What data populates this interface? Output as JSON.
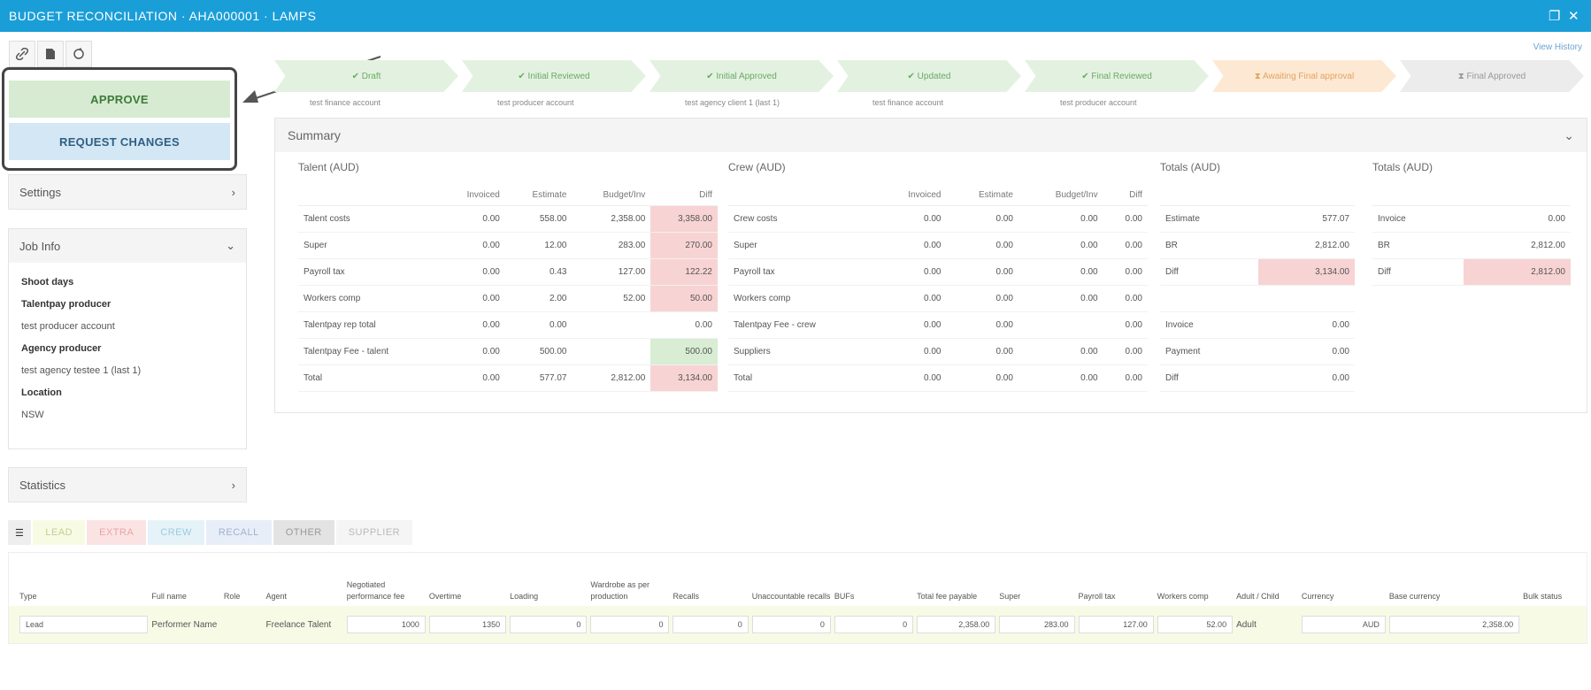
{
  "window": {
    "title": "BUDGET RECONCILIATION · AHA000001 · LAMPS",
    "restore_glyph": "❐",
    "close_glyph": "✕"
  },
  "toolbar": {
    "icons": [
      "link-icon",
      "document-icon",
      "refresh-icon"
    ]
  },
  "view_history": "View History",
  "actions": {
    "approve": "APPROVE",
    "request_changes": "REQUEST CHANGES"
  },
  "workflow": [
    {
      "label": "✔ Draft",
      "sub": "test finance account",
      "state": "done"
    },
    {
      "label": "✔ Initial Reviewed",
      "sub": "test producer account",
      "state": "done"
    },
    {
      "label": "✔ Initial Approved",
      "sub": "test agency client 1 (last 1)",
      "state": "done"
    },
    {
      "label": "✔ Updated",
      "sub": "test finance account",
      "state": "done"
    },
    {
      "label": "✔ Final Reviewed",
      "sub": "test producer account",
      "state": "done"
    },
    {
      "label": "⧗ Awaiting Final approval",
      "sub": "",
      "state": "pending"
    },
    {
      "label": "⧗ Final Approved",
      "sub": "",
      "state": "todo"
    }
  ],
  "sidebar": {
    "settings": "Settings",
    "job_info": {
      "title": "Job Info",
      "lines": [
        {
          "text": "Shoot days",
          "bold": true
        },
        {
          "text": "Talentpay producer",
          "bold": true
        },
        {
          "text": "test producer account",
          "bold": false
        },
        {
          "text": "Agency producer",
          "bold": true
        },
        {
          "text": "test agency testee 1 (last 1)",
          "bold": false
        },
        {
          "text": "Location",
          "bold": true
        },
        {
          "text": "NSW",
          "bold": false
        }
      ]
    },
    "statistics": "Statistics"
  },
  "summary": {
    "title": "Summary",
    "talent": {
      "title": "Talent (AUD)",
      "headers": [
        "Invoiced",
        "Estimate",
        "Budget/Inv",
        "Diff"
      ],
      "rows": [
        {
          "label": "Talent costs",
          "v": [
            "0.00",
            "558.00",
            "2,358.00",
            "3,358.00"
          ],
          "diff": "neg"
        },
        {
          "label": "Super",
          "v": [
            "0.00",
            "12.00",
            "283.00",
            "270.00"
          ],
          "diff": "neg"
        },
        {
          "label": "Payroll tax",
          "v": [
            "0.00",
            "0.43",
            "127.00",
            "122.22"
          ],
          "diff": "neg"
        },
        {
          "label": "Workers comp",
          "v": [
            "0.00",
            "2.00",
            "52.00",
            "50.00"
          ],
          "diff": "neg"
        },
        {
          "label": "Talentpay rep total",
          "v": [
            "0.00",
            "0.00",
            "",
            "0.00"
          ],
          "diff": ""
        },
        {
          "label": "Talentpay Fee - talent",
          "v": [
            "0.00",
            "500.00",
            "",
            "500.00"
          ],
          "diff": "pos"
        },
        {
          "label": "Total",
          "v": [
            "0.00",
            "577.07",
            "2,812.00",
            "3,134.00"
          ],
          "diff": "neg"
        }
      ]
    },
    "crew": {
      "title": "Crew (AUD)",
      "headers": [
        "Invoiced",
        "Estimate",
        "Budget/Inv",
        "Diff"
      ],
      "rows": [
        {
          "label": "Crew costs",
          "v": [
            "0.00",
            "0.00",
            "0.00",
            "0.00"
          ]
        },
        {
          "label": "Super",
          "v": [
            "0.00",
            "0.00",
            "0.00",
            "0.00"
          ]
        },
        {
          "label": "Payroll tax",
          "v": [
            "0.00",
            "0.00",
            "0.00",
            "0.00"
          ]
        },
        {
          "label": "Workers comp",
          "v": [
            "0.00",
            "0.00",
            "0.00",
            "0.00"
          ]
        },
        {
          "label": "Talentpay Fee - crew",
          "v": [
            "0.00",
            "0.00",
            "",
            "0.00"
          ]
        },
        {
          "label": "Suppliers",
          "v": [
            "0.00",
            "0.00",
            "0.00",
            "0.00"
          ]
        },
        {
          "label": "Total",
          "v": [
            "0.00",
            "0.00",
            "0.00",
            "0.00"
          ]
        }
      ]
    },
    "totals_left": {
      "title": "Totals (AUD)",
      "rows": [
        {
          "label": "Estimate",
          "v": "577.07",
          "hl": ""
        },
        {
          "label": "BR",
          "v": "2,812.00",
          "hl": ""
        },
        {
          "label": "Diff",
          "v": "3,134.00",
          "hl": "neg"
        },
        {
          "label": "",
          "v": "",
          "hl": ""
        },
        {
          "label": "Invoice",
          "v": "0.00",
          "hl": ""
        },
        {
          "label": "Payment",
          "v": "0.00",
          "hl": ""
        },
        {
          "label": "Diff",
          "v": "0.00",
          "hl": ""
        }
      ]
    },
    "totals_right": {
      "title": "Totals (AUD)",
      "rows": [
        {
          "label": "Invoice",
          "v": "0.00",
          "hl": ""
        },
        {
          "label": "BR",
          "v": "2,812.00",
          "hl": ""
        },
        {
          "label": "Diff",
          "v": "2,812.00",
          "hl": "neg"
        }
      ]
    }
  },
  "tabs": [
    {
      "label": "LEAD",
      "bg": "#f8fbe4",
      "fg": "#c4cf92"
    },
    {
      "label": "EXTRA",
      "bg": "#fbe3e3",
      "fg": "#e9a5a5"
    },
    {
      "label": "CREW",
      "bg": "#e5f3f8",
      "fg": "#9bcbe0"
    },
    {
      "label": "RECALL",
      "bg": "#e8eef7",
      "fg": "#9fb1cf"
    },
    {
      "label": "OTHER",
      "bg": "#e3e3e3",
      "fg": "#9a9a9a"
    },
    {
      "label": "SUPPLIER",
      "bg": "#f5f5f5",
      "fg": "#b9b9b9"
    }
  ],
  "grid": {
    "headers": [
      "Type",
      "Full name",
      "Role",
      "Agent",
      "Negotiated performance fee",
      "Overtime",
      "Loading",
      "Wardrobe as per production",
      "Recalls",
      "Unaccountable recalls",
      "BUFs",
      "Total fee payable",
      "Super",
      "Payroll tax",
      "Workers comp",
      "Adult / Child",
      "Currency",
      "Base currency",
      "Bulk status"
    ],
    "row": {
      "type": "Lead",
      "full_name": "Performer Name",
      "role": "",
      "agent": "Freelance Talent",
      "fee": "1000",
      "overtime": "1350",
      "loading": "0",
      "wardrobe": "0",
      "recalls": "0",
      "unaccountable": "0",
      "bufs": "0",
      "total": "2,358.00",
      "super": "283.00",
      "payroll": "127.00",
      "workers": "52.00",
      "adult": "Adult",
      "currency": "AUD",
      "base": "2,358.00",
      "bulk": ""
    }
  }
}
